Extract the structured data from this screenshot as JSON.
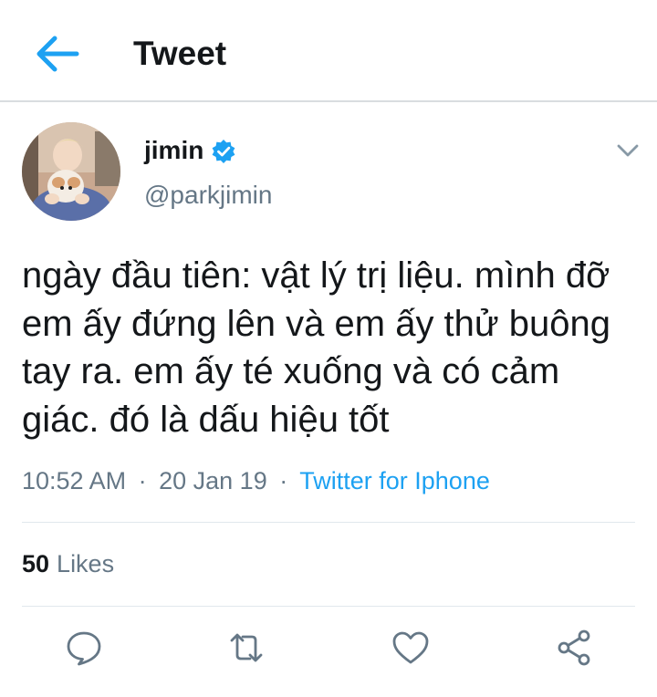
{
  "header": {
    "title": "Tweet",
    "back_icon": "arrow-left-icon"
  },
  "tweet": {
    "author_name": "jimin",
    "author_handle": "@parkjimin",
    "verified": true,
    "text": "ngày đầu tiên: vật lý trị liệu. mình đỡ em ấy đứng lên và em ấy thử buông tay ra. em ấy té xuống và có cảm giác. đó là dấu hiệu tốt",
    "time": "10:52 AM",
    "date": "20 Jan 19",
    "separator": "·",
    "source": "Twitter for Iphone",
    "likes_count": "50",
    "likes_label": "Likes"
  },
  "actions": {
    "icons": [
      "comment-icon",
      "retweet-icon",
      "heart-icon",
      "share-icon"
    ]
  },
  "colors": {
    "accent": "#1da1f2",
    "secondary_text": "#657786",
    "primary_text": "#14171a",
    "divider": "#e1e8ed"
  }
}
